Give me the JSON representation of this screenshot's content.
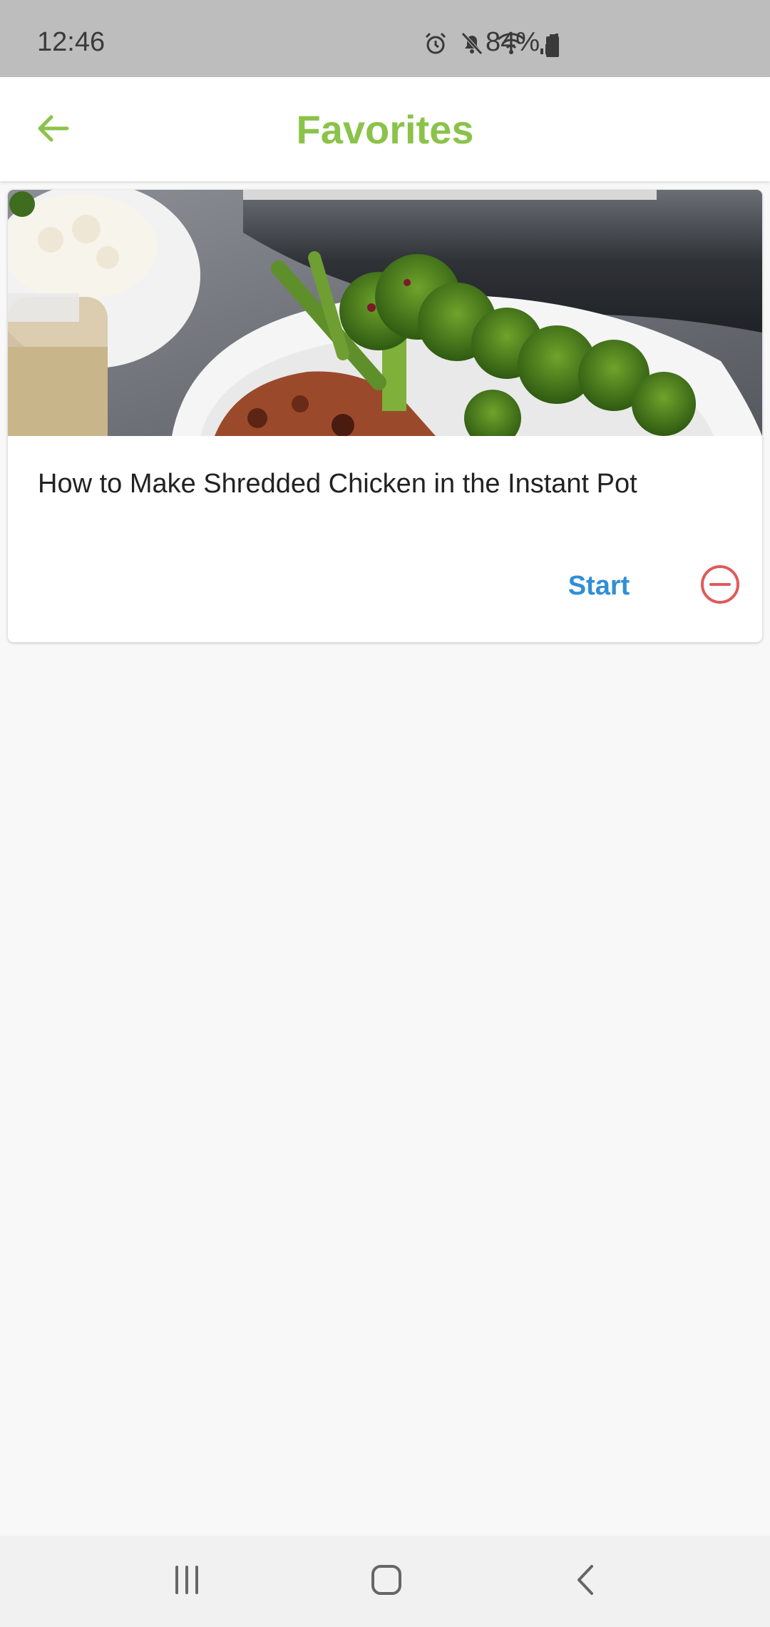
{
  "status_bar": {
    "time": "12:46",
    "battery_percent": "84%",
    "icons": [
      "alarm-icon",
      "mute-icon",
      "wifi-icon",
      "signal-icon",
      "battery-icon"
    ]
  },
  "app_bar": {
    "title": "Favorites",
    "back_icon": "arrow-left-icon",
    "accent_color": "#8bc34a"
  },
  "favorites": [
    {
      "title": "How to Make Shredded Chicken in the Instant Pot",
      "start_label": "Start",
      "remove_icon": "remove-circle-icon"
    }
  ],
  "colors": {
    "start": "#2f8fd6",
    "remove": "#e05a5a",
    "background": "#f8f8f8"
  },
  "nav_bar": {
    "buttons": [
      "recent-apps-icon",
      "home-icon",
      "back-icon"
    ]
  }
}
